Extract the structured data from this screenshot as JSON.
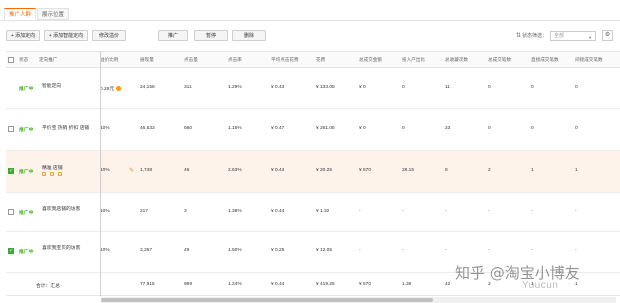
{
  "tabs": [
    {
      "label": "推广人群",
      "active": true
    },
    {
      "label": "展示位置",
      "active": false
    }
  ],
  "toolbar": {
    "buttons": [
      {
        "label": "+ 添加定向"
      },
      {
        "label": "+ 添加智能定向"
      },
      {
        "label": "修改溢价"
      },
      {
        "label": "推广"
      },
      {
        "label": "暂停"
      },
      {
        "label": "删除"
      }
    ],
    "filter_label": "状态筛选：",
    "filter_value": "全部"
  },
  "columns": [
    "状态",
    "定向推广",
    "溢价比例",
    "展现量",
    "点击量",
    "点击率",
    "平均点击花费",
    "花费",
    "总成交金额",
    "投入产出比",
    "总收藏次数",
    "总成交笔数",
    "直接成交笔数",
    "间接成交笔数"
  ],
  "rows": [
    {
      "status": "推广中",
      "name": "智能定向",
      "bid": "0.26元",
      "impr": "24,158",
      "clicks": "311",
      "ctr": "1.29%",
      "cpc": "¥ 0.43",
      "cost": "¥ 133.08",
      "gmv": "¥ 0",
      "roi": "0",
      "fav": "11",
      "orders": "0",
      "direct": "0",
      "indirect": "0",
      "checked": true,
      "coin": true
    },
    {
      "status": "推广中",
      "name": "平价宝 热销 折扣 店铺",
      "bid": "10%",
      "impr": "46,533",
      "clicks": "560",
      "ctr": "1.15%",
      "cpc": "¥ 0.47",
      "cost": "¥ 261.06",
      "gmv": "¥ 0",
      "roi": "0",
      "fav": "23",
      "orders": "0",
      "direct": "0",
      "indirect": "0",
      "checked": false,
      "coin": false
    },
    {
      "status": "推广中",
      "name": "精准 店铺",
      "bid": "10%",
      "impr": "1,748",
      "clicks": "46",
      "ctr": "2.63%",
      "cpc": "¥ 0.44",
      "cost": "¥ 20.25",
      "gmv": "¥ 570",
      "roi": "28.15",
      "fav": "8",
      "orders": "2",
      "direct": "1",
      "indirect": "1",
      "checked": true,
      "coin": false
    },
    {
      "status": "推广中",
      "name": "喜欢我店铺的访客",
      "bid": "10%",
      "impr": "217",
      "clicks": "3",
      "ctr": "1.38%",
      "cpc": "¥ 0.44",
      "cost": "¥ 1.32",
      "gmv": "-",
      "roi": "-",
      "fav": "-",
      "orders": "-",
      "direct": "-",
      "indirect": "-",
      "checked": false,
      "coin": false
    },
    {
      "status": "推广中",
      "name": "喜欢我宝贝的访客",
      "bid": "10%",
      "impr": "3,267",
      "clicks": "49",
      "ctr": "1.50%",
      "cpc": "¥ 0.25",
      "cost": "¥ 12.05",
      "gmv": "-",
      "roi": "-",
      "fav": "-",
      "orders": "-",
      "direct": "-",
      "indirect": "-",
      "checked": true,
      "coin": false
    }
  ],
  "summary": {
    "label": "合计：汇总",
    "impr": "77,915",
    "clicks": "969",
    "ctr": "1.24%",
    "cpc": "¥ 0.44",
    "cost": "¥ 419.25",
    "gmv": "¥ 570",
    "roi": "1.36",
    "fav": "42",
    "orders": "2",
    "direct": "1",
    "indirect": "1"
  },
  "watermark": {
    "main": "知乎 @淘宝小博友",
    "sub": "Yuucun"
  },
  "icons": {
    "settings": "gear-icon",
    "dropdown": "chevron-down-icon",
    "edit": "pencil-icon",
    "coin": "coin-icon"
  },
  "colors": {
    "accent": "#ff6a00",
    "status_green": "#4caf28",
    "highlight_row": "#fdf3ea"
  }
}
